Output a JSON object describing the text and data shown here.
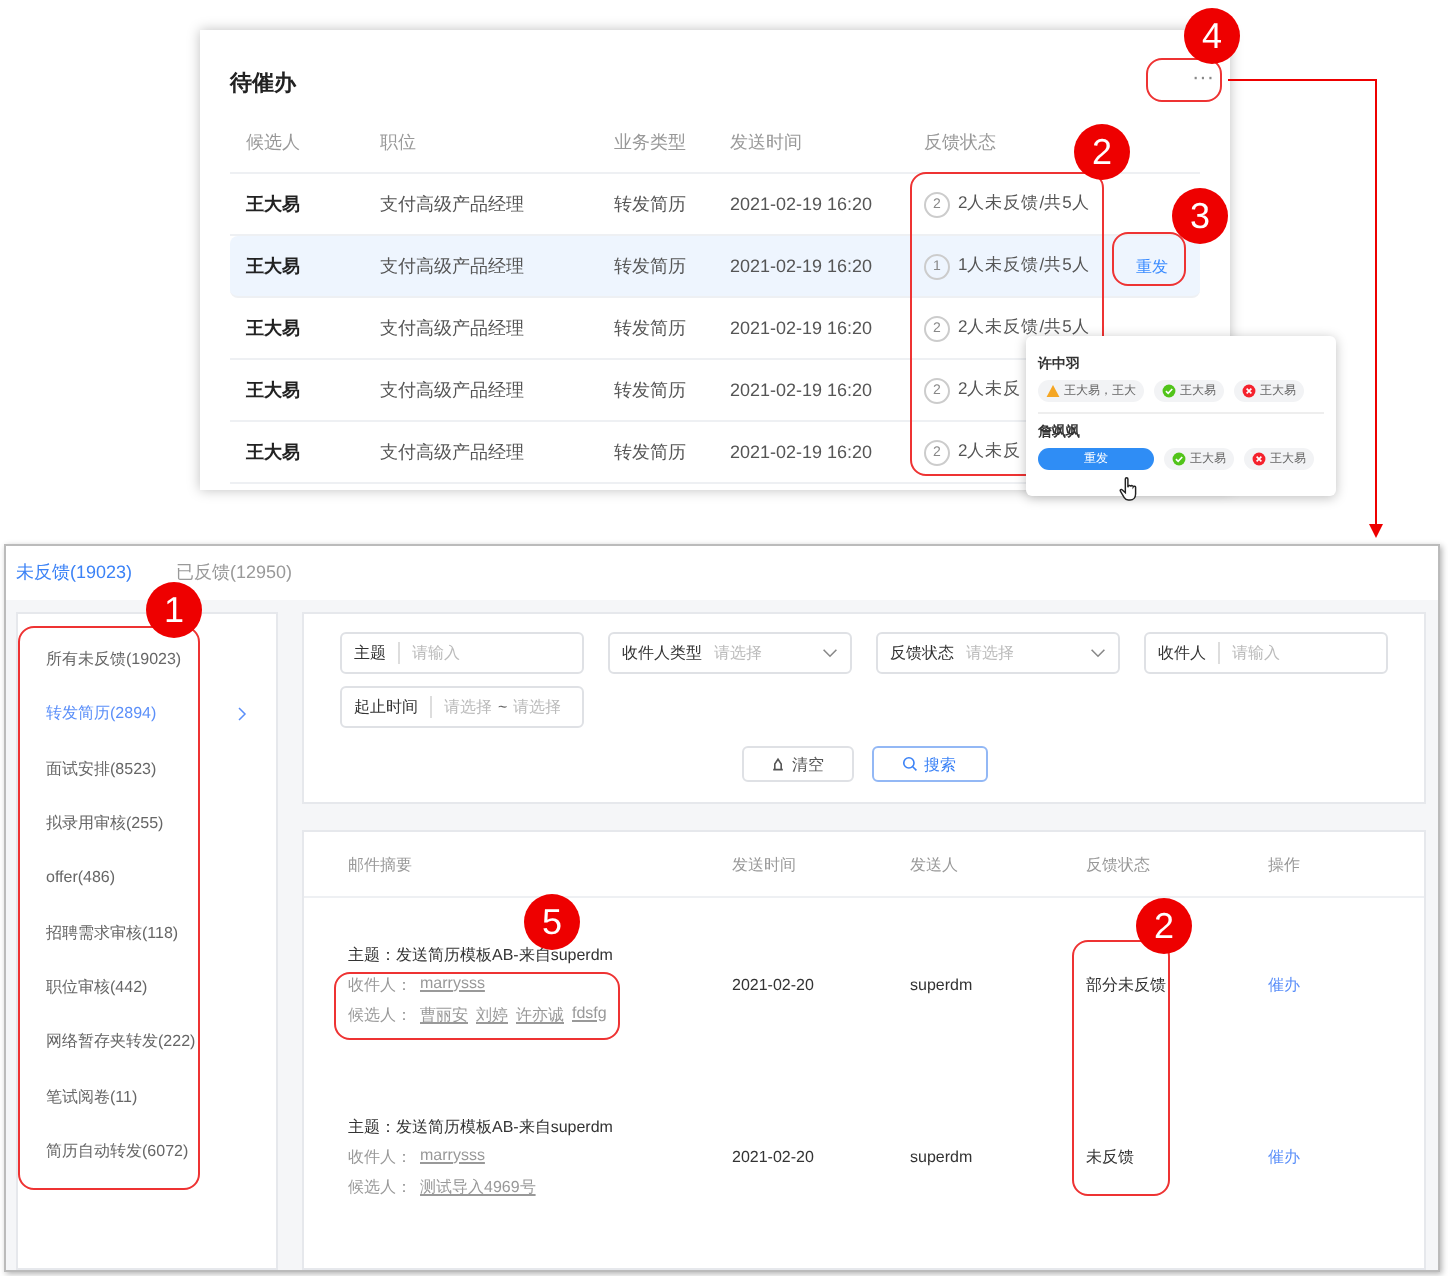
{
  "pending_card": {
    "title": "待催办",
    "more_button": "···",
    "columns": [
      "候选人",
      "职位",
      "业务类型",
      "发送时间",
      "反馈状态"
    ],
    "rows": [
      {
        "candidate": "王大易",
        "position": "支付高级产品经理",
        "type": "转发简历",
        "time": "2021-02-19 16:20",
        "count": "2",
        "feedback": "2人未反馈/共5人",
        "selected": false
      },
      {
        "candidate": "王大易",
        "position": "支付高级产品经理",
        "type": "转发简历",
        "time": "2021-02-19 16:20",
        "count": "1",
        "feedback": "1人未反馈/共5人",
        "selected": true,
        "action": "重发"
      },
      {
        "candidate": "王大易",
        "position": "支付高级产品经理",
        "type": "转发简历",
        "time": "2021-02-19 16:20",
        "count": "2",
        "feedback": "2人未反馈/共5人",
        "selected": false
      },
      {
        "candidate": "王大易",
        "position": "支付高级产品经理",
        "type": "转发简历",
        "time": "2021-02-19 16:20",
        "count": "2",
        "feedback": "2人未反",
        "selected": false
      },
      {
        "candidate": "王大易",
        "position": "支付高级产品经理",
        "type": "转发简历",
        "time": "2021-02-19 16:20",
        "count": "2",
        "feedback": "2人未反",
        "selected": false
      }
    ]
  },
  "popover": {
    "groups": [
      {
        "name": "许中羽",
        "chips": [
          {
            "kind": "warning",
            "text": "王大易，王大"
          },
          {
            "kind": "ok",
            "text": "王大易"
          },
          {
            "kind": "error",
            "text": "王大易"
          }
        ]
      },
      {
        "name": "詹飒飒",
        "resend_button": "重发",
        "chips": [
          {
            "kind": "ok",
            "text": "王大易"
          },
          {
            "kind": "error",
            "text": "王大易"
          }
        ]
      }
    ]
  },
  "feedback_page": {
    "tabs": [
      {
        "label": "未反馈(19023)",
        "selected": true
      },
      {
        "label": "已反馈(12950)",
        "selected": false
      }
    ],
    "sidebar": {
      "items": [
        {
          "label": "所有未反馈(19023)",
          "selected": false
        },
        {
          "label": "转发简历(2894)",
          "selected": true
        },
        {
          "label": "面试安排(8523)",
          "selected": false
        },
        {
          "label": "拟录用审核(255)",
          "selected": false
        },
        {
          "label": "offer(486)",
          "selected": false
        },
        {
          "label": "招聘需求审核(118)",
          "selected": false
        },
        {
          "label": "职位审核(442)",
          "selected": false
        },
        {
          "label": "网络暂存夹转发(222)",
          "selected": false
        },
        {
          "label": "笔试阅卷(11)",
          "selected": false
        },
        {
          "label": "简历自动转发(6072)",
          "selected": false
        }
      ]
    },
    "filters": [
      {
        "kind": "input",
        "label": "主题",
        "placeholder": "请输入"
      },
      {
        "kind": "select",
        "label": "收件人类型",
        "placeholder": "请选择"
      },
      {
        "kind": "select",
        "label": "反馈状态",
        "placeholder": "请选择"
      },
      {
        "kind": "input",
        "label": "收件人",
        "placeholder": "请输入"
      },
      {
        "kind": "range",
        "label": "起止时间",
        "placeholder": "请选择",
        "separator": "~",
        "end_placeholder": "请选择"
      }
    ],
    "clear_button": "清空",
    "search_button": "搜索",
    "mail_table": {
      "columns": [
        "邮件摘要",
        "发送时间",
        "发送人",
        "反馈状态",
        "操作"
      ],
      "rows": [
        {
          "subject": "主题：发送简历模板AB-来自superdm",
          "recipient_label": "收件人：",
          "recipients": [
            "marrysss"
          ],
          "candidate_label": "候选人：",
          "candidates": [
            "曹丽安",
            "刘婷",
            "许亦诚",
            "fdsfg"
          ],
          "time": "2021-02-20",
          "sender": "superdm",
          "status": "部分未反馈",
          "action": "催办"
        },
        {
          "subject": "主题：发送简历模板AB-来自superdm",
          "recipient_label": "收件人：",
          "recipients": [
            "marrysss"
          ],
          "candidate_label": "候选人：",
          "candidates": [
            "测试导入4969号"
          ],
          "time": "2021-02-20",
          "sender": "superdm",
          "status": "未反馈",
          "action": "催办"
        }
      ]
    }
  },
  "callouts": [
    "4",
    "2",
    "3",
    "1",
    "5",
    "2"
  ]
}
